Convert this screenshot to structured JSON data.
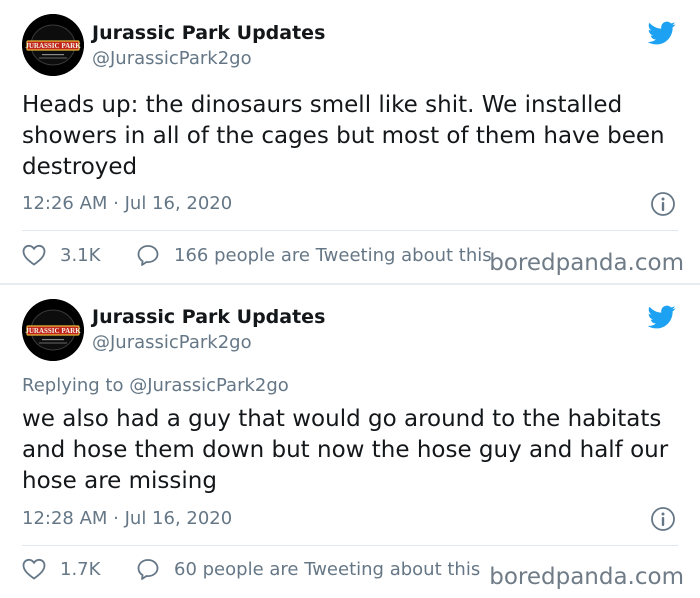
{
  "tweets": [
    {
      "account_name": "Jurassic Park Updates",
      "handle": "@JurassicPark2go",
      "replying_to": "",
      "text": "Heads up: the dinosaurs smell like shit. We installed showers in all of the cages but most of them have been destroyed",
      "timestamp": "12:26 AM · Jul 16, 2020",
      "likes": "3.1K",
      "conversation": "166 people are Tweeting about this"
    },
    {
      "account_name": "Jurassic Park Updates",
      "handle": "@JurassicPark2go",
      "replying_to_prefix": "Replying to ",
      "replying_to": "@JurassicPark2go",
      "text": "we also had a guy that would go around to the habitats and hose them down but now the hose guy and half our hose are missing",
      "timestamp": "12:28 AM · Jul 16, 2020",
      "likes": "1.7K",
      "conversation": "60 people are Tweeting about this"
    }
  ],
  "watermark": "boredpanda.com",
  "avatar_logo_text": "JURASSIC PARK",
  "colors": {
    "twitter_blue": "#1da1f2",
    "secondary_text": "#657786",
    "primary_text": "#14171a",
    "avatar_red": "#c0241b",
    "avatar_gold": "#e8b83a"
  },
  "icons": {
    "brand": "twitter-bird-icon",
    "info": "info-icon",
    "like": "heart-icon",
    "conversation": "speech-bubble-icon"
  }
}
